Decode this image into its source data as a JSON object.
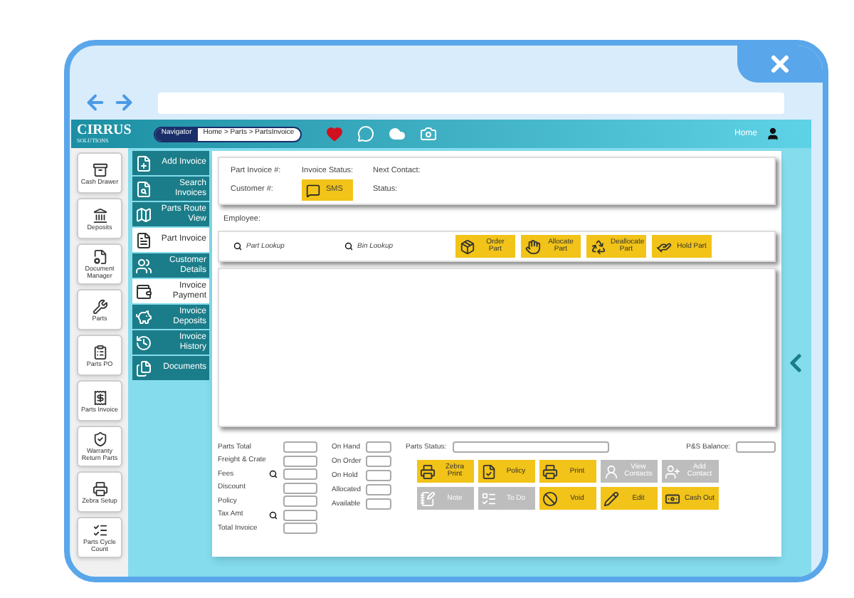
{
  "header": {
    "logo": "CIRRUS",
    "logo_sub": "SOLUTIONS",
    "navigator": "Navigator",
    "breadcrumb": "Home > Parts > PartsInvoice",
    "home": "Home"
  },
  "tools": [
    {
      "label": "Cash Drawer"
    },
    {
      "label": "Deposits"
    },
    {
      "label": "Document Manager"
    },
    {
      "label": "Parts"
    },
    {
      "label": "Parts PO"
    },
    {
      "label": "Parts Invoice"
    },
    {
      "label": "Warranty Return Parts"
    },
    {
      "label": "Zebra Setup"
    },
    {
      "label": "Parts Cycle Count"
    }
  ],
  "menu": [
    {
      "label": "Add Invoice",
      "selected": false
    },
    {
      "label": "Search Invoices",
      "selected": false
    },
    {
      "label": "Parts Route View",
      "selected": false
    },
    {
      "label": "Part Invoice",
      "selected": true
    },
    {
      "label": "Customer Details",
      "selected": false
    },
    {
      "label": "Invoice Payment",
      "selected": true
    },
    {
      "label": "Invoice Deposits",
      "selected": false
    },
    {
      "label": "Invoice History",
      "selected": false
    },
    {
      "label": "Documents",
      "selected": false
    }
  ],
  "invoice": {
    "part_invoice": "Part Invoice #:",
    "invoice_status": "Invoice Status:",
    "next_contact": "Next Contact:",
    "customer": "Customer #:",
    "sms": "SMS",
    "status": "Status:"
  },
  "employee": "Employee:",
  "lookups": [
    "Part Lookup",
    "Bin Lookup"
  ],
  "part_actions": [
    "Order Part",
    "Allocate Part",
    "Deallocate Part",
    "Hold Part"
  ],
  "totals": [
    {
      "label": "Parts Total",
      "search": false
    },
    {
      "label": "Freight & Crate",
      "search": false
    },
    {
      "label": "Fees",
      "search": true
    },
    {
      "label": "Discount",
      "search": false
    },
    {
      "label": "Policy",
      "search": false
    },
    {
      "label": "Tax Amt",
      "search": true
    },
    {
      "label": "Total Invoice",
      "search": false
    }
  ],
  "stock": [
    "On Hand",
    "On Order",
    "On Hold",
    "Allocated",
    "Available"
  ],
  "parts_status": "Parts Status:",
  "ps_balance": "P&S Balance:",
  "actions": [
    {
      "label": "Zebra Print",
      "disabled": false
    },
    {
      "label": "Policy",
      "disabled": false
    },
    {
      "label": "Print",
      "disabled": false
    },
    {
      "label": "View Contacts",
      "disabled": true
    },
    {
      "label": "Add Contact",
      "disabled": true
    },
    {
      "label": "Note",
      "disabled": true
    },
    {
      "label": "To Do",
      "disabled": true
    },
    {
      "label": "Void",
      "disabled": false
    },
    {
      "label": "Edit",
      "disabled": false
    },
    {
      "label": "Cash Out",
      "disabled": false
    }
  ]
}
